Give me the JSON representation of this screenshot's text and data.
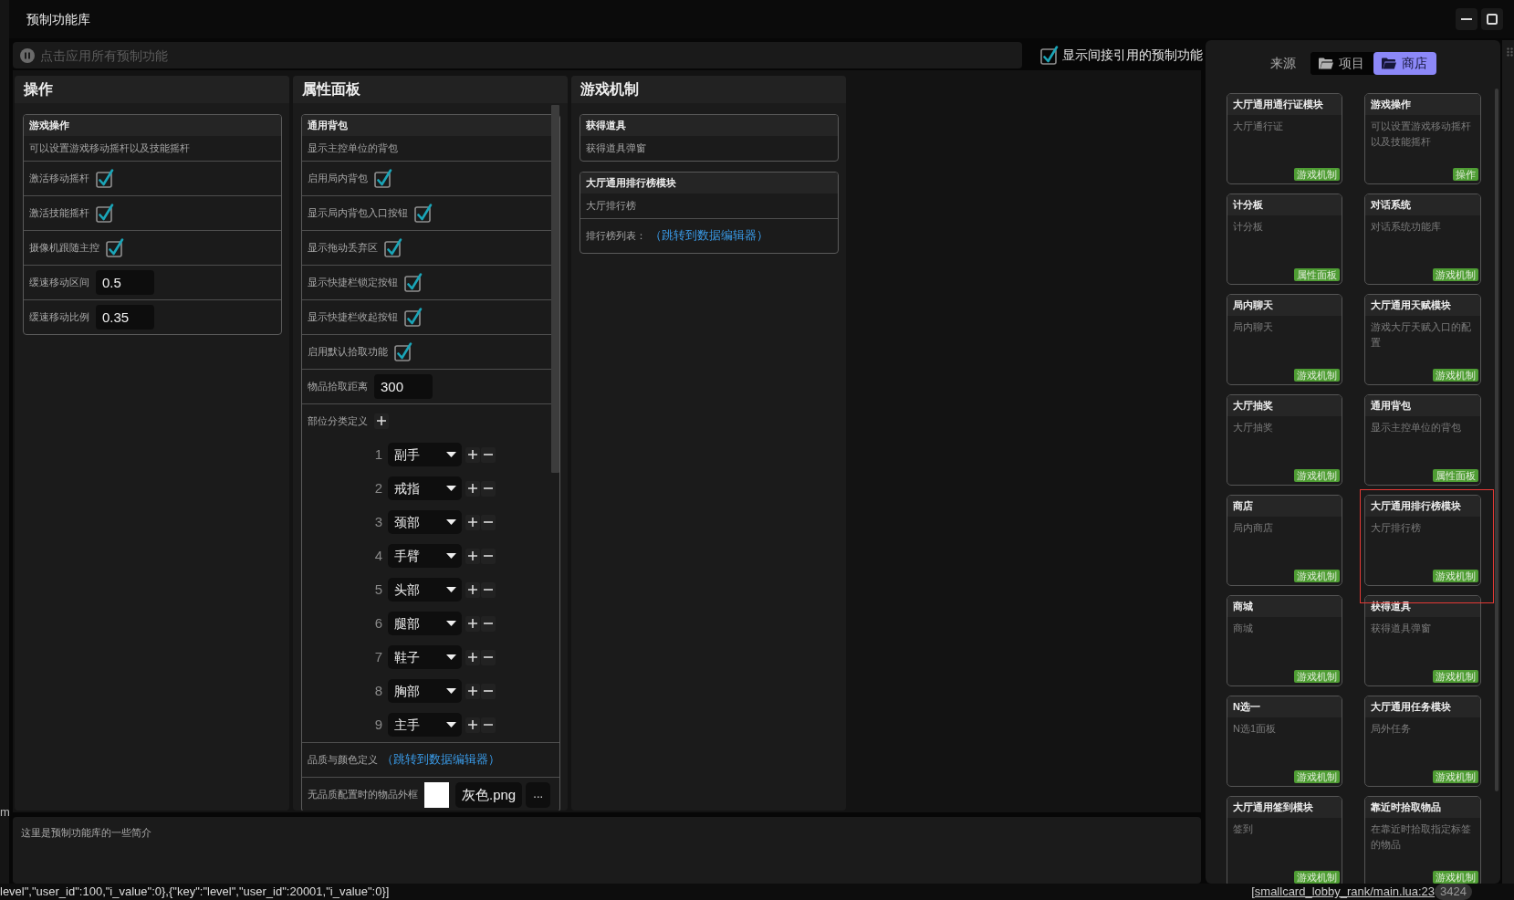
{
  "window": {
    "title": "预制功能库"
  },
  "search": {
    "placeholder": "点击应用所有预制功能"
  },
  "show_indirect": {
    "label": "显示间接引用的预制功能",
    "checked": true
  },
  "columns": [
    {
      "title": "操作",
      "cards": [
        {
          "title": "游戏操作",
          "description": "可以设置游戏移动摇杆以及技能摇杆",
          "fields": [
            {
              "kind": "checkbox",
              "label": "激活移动摇杆",
              "checked": true
            },
            {
              "kind": "checkbox",
              "label": "激活技能摇杆",
              "checked": true
            },
            {
              "kind": "checkbox",
              "label": "摄像机跟随主控",
              "checked": true
            },
            {
              "kind": "number",
              "label": "缓速移动区间",
              "value": "0.5"
            },
            {
              "kind": "number",
              "label": "缓速移动比例",
              "value": "0.35"
            }
          ]
        }
      ]
    },
    {
      "title": "属性面板",
      "cards": [
        {
          "title": "通用背包",
          "description": "显示主控单位的背包",
          "fields": [
            {
              "kind": "checkbox",
              "label": "启用局内背包",
              "checked": true
            },
            {
              "kind": "checkbox",
              "label": "显示局内背包入口按钮",
              "checked": true
            },
            {
              "kind": "checkbox",
              "label": "显示拖动丢弃区",
              "checked": true
            },
            {
              "kind": "checkbox",
              "label": "显示快捷栏锁定按钮",
              "checked": true
            },
            {
              "kind": "checkbox",
              "label": "显示快捷栏收起按钮",
              "checked": true
            },
            {
              "kind": "checkbox",
              "label": "启用默认拾取功能",
              "checked": true
            },
            {
              "kind": "number",
              "label": "物品拾取距离",
              "value": "300"
            },
            {
              "kind": "list",
              "label": "部位分类定义",
              "items": [
                {
                  "index": "1",
                  "value": "副手"
                },
                {
                  "index": "2",
                  "value": "戒指"
                },
                {
                  "index": "3",
                  "value": "颈部"
                },
                {
                  "index": "4",
                  "value": "手臂"
                },
                {
                  "index": "5",
                  "value": "头部"
                },
                {
                  "index": "6",
                  "value": "腿部"
                },
                {
                  "index": "7",
                  "value": "鞋子"
                },
                {
                  "index": "8",
                  "value": "胸部"
                },
                {
                  "index": "9",
                  "value": "主手"
                }
              ]
            },
            {
              "kind": "link",
              "label": "品质与颜色定义",
              "link": "（跳转到数据编辑器）"
            },
            {
              "kind": "image",
              "label": "无品质配置时的物品外框",
              "value": "灰色.png",
              "button": "..."
            }
          ]
        }
      ]
    },
    {
      "title": "游戏机制",
      "cards": [
        {
          "title": "获得道具",
          "description": "获得道具弹窗"
        },
        {
          "title": "大厅通用排行榜模块",
          "description": "大厅排行榜",
          "fields": [
            {
              "kind": "link",
              "label": "排行榜列表：",
              "link": "（跳转到数据编辑器）"
            }
          ]
        }
      ]
    }
  ],
  "description": "这里是预制功能库的一些简介",
  "source": {
    "label": "来源",
    "options": [
      {
        "label": "项目",
        "selected": false
      },
      {
        "label": "商店",
        "selected": true
      }
    ]
  },
  "store_cards": [
    {
      "title": "大厅通用通行证模块",
      "description": "大厅通行证",
      "tag": "游戏机制",
      "selected": false
    },
    {
      "title": "游戏操作",
      "description": "可以设置游戏移动摇杆以及技能摇杆",
      "tag": "操作",
      "selected": false
    },
    {
      "title": "计分板",
      "description": "计分板",
      "tag": "属性面板",
      "selected": false
    },
    {
      "title": "对话系统",
      "description": "对话系统功能库",
      "tag": "游戏机制",
      "selected": false
    },
    {
      "title": "局内聊天",
      "description": "局内聊天",
      "tag": "游戏机制",
      "selected": false
    },
    {
      "title": "大厅通用天赋模块",
      "description": "游戏大厅天赋入口的配置",
      "tag": "游戏机制",
      "selected": false
    },
    {
      "title": "大厅抽奖",
      "description": "大厅抽奖",
      "tag": "游戏机制",
      "selected": false
    },
    {
      "title": "通用背包",
      "description": "显示主控单位的背包",
      "tag": "属性面板",
      "selected": false
    },
    {
      "title": "商店",
      "description": "局内商店",
      "tag": "游戏机制",
      "selected": false
    },
    {
      "title": "大厅通用排行榜模块",
      "description": "大厅排行榜",
      "tag": "游戏机制",
      "selected": true
    },
    {
      "title": "商城",
      "description": "商城",
      "tag": "游戏机制",
      "selected": false
    },
    {
      "title": "获得道具",
      "description": "获得道具弹窗",
      "tag": "游戏机制",
      "selected": false
    },
    {
      "title": "N选一",
      "description": "N选1面板",
      "tag": "游戏机制",
      "selected": false
    },
    {
      "title": "大厅通用任务模块",
      "description": "局外任务",
      "tag": "游戏机制",
      "selected": false
    },
    {
      "title": "大厅通用签到模块",
      "description": "签到",
      "tag": "游戏机制",
      "selected": false
    },
    {
      "title": "靠近时拾取物品",
      "description": "在靠近时拾取指定标签的物品",
      "tag": "游戏机制",
      "selected": false
    }
  ],
  "console": {
    "log": "level\",\"user_id\":100,\"i_value\":0},{\"key\":\"level\",\"user_id\":20001,\"i_value\":0}]",
    "source": "[smallcard_lobby_rank/main.lua:23",
    "count": "3424"
  },
  "background_app": {
    "text": "m"
  }
}
